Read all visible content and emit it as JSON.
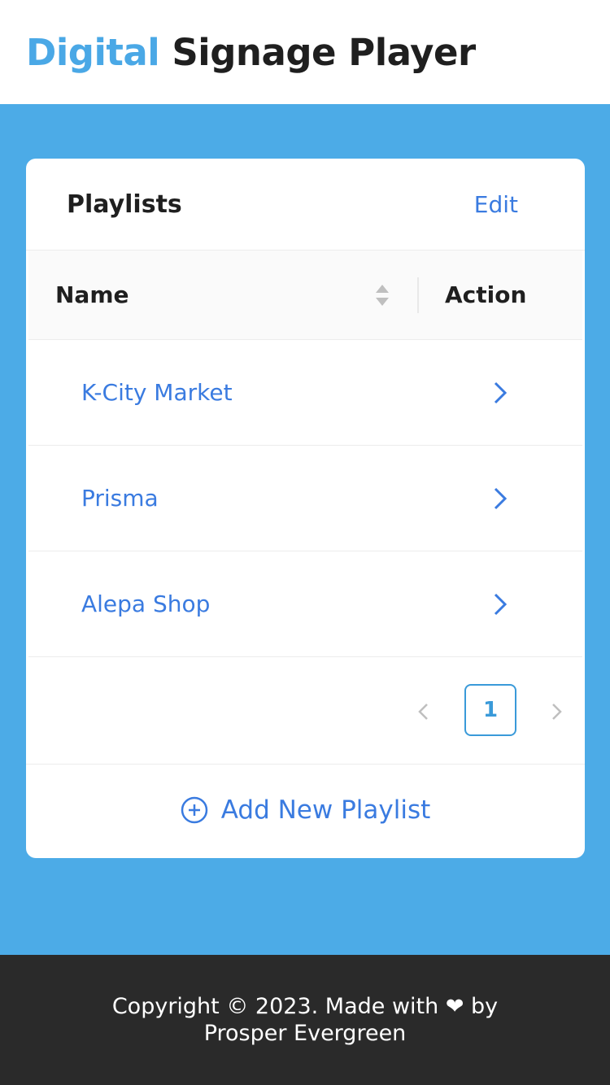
{
  "header": {
    "brand_accent": "Digital",
    "brand_rest": "Signage Player"
  },
  "card": {
    "title": "Playlists",
    "edit_label": "Edit",
    "columns": {
      "name": "Name",
      "action": "Action"
    },
    "rows": [
      {
        "name": "K-City Market"
      },
      {
        "name": "Prisma"
      },
      {
        "name": "Alepa Shop"
      }
    ],
    "pagination": {
      "current_page": "1"
    },
    "add_label": "Add New Playlist"
  },
  "footer": {
    "line1": "Copyright © 2023. Made with ❤ by",
    "line2": "Prosper Evergreen"
  },
  "colors": {
    "accent": "#4aa8e6",
    "background": "#4cabe7",
    "link": "#3a7be0",
    "footer_bg": "#2a2a2a"
  }
}
